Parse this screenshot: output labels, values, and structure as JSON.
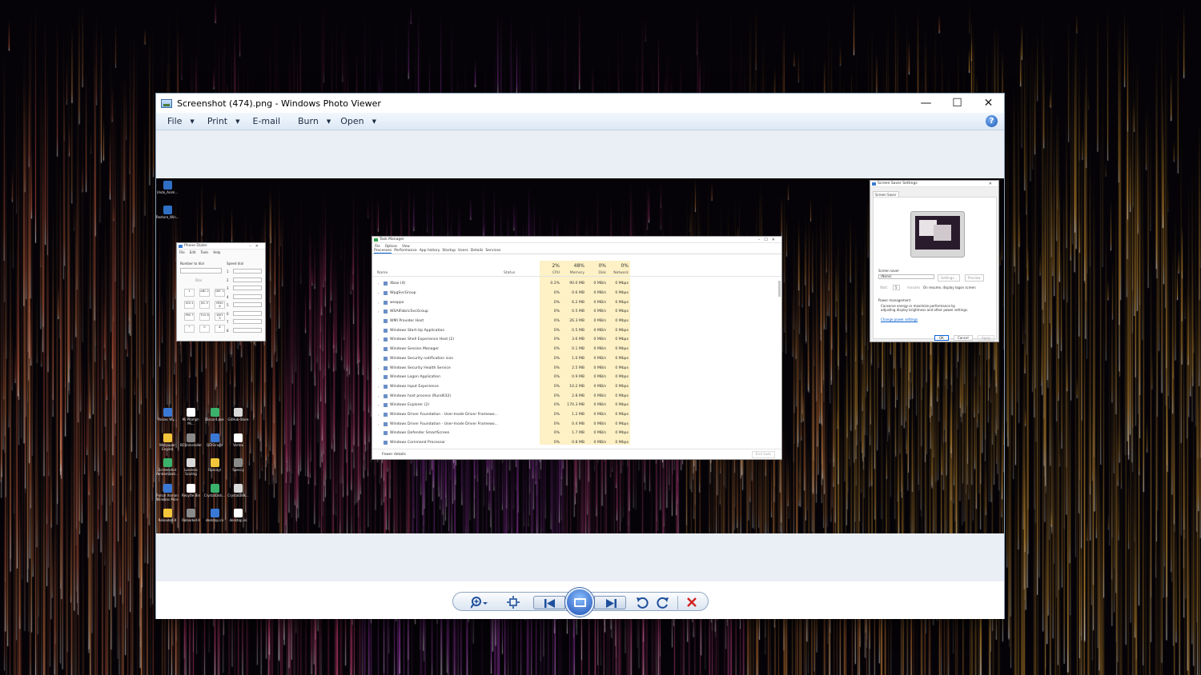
{
  "window": {
    "title": "Screenshot (474).png - Windows Photo Viewer",
    "controls": [
      "—",
      "☐",
      "✕"
    ]
  },
  "menu": [
    {
      "label": "File",
      "dropdown": true
    },
    {
      "label": "Print",
      "dropdown": true
    },
    {
      "label": "E-mail",
      "dropdown": false
    },
    {
      "label": "Burn",
      "dropdown": true
    },
    {
      "label": "Open",
      "dropdown": true
    }
  ],
  "help": {
    "label": "?"
  },
  "toolbar": {
    "zoom_icon": "zoom-icon",
    "fit_icon": "actual-size-icon",
    "prev_icon": "previous-icon",
    "slideshow_icon": "slideshow-icon",
    "next_icon": "next-icon",
    "rotate_ccw_icon": "rotate-counterclockwise-icon",
    "rotate_cw_icon": "rotate-clockwise-icon",
    "delete_icon": "delete-icon"
  },
  "photo": {
    "desktop_icons_top": [
      "Undo_Anim...",
      "Restore_Win..."
    ],
    "desktop_icons_grid": [
      [
        "Parsec Wy...",
        "Mi Prompt-Mi...",
        "Discord.exe",
        "GitHub-Store"
      ],
      [
        "Wallpaper Engine",
        "BCUninstaller",
        "QGIS/nuts",
        "Vortex"
      ],
      [
        "Screenshot randomizati...",
        "Lossless Scaling",
        "Upscayl",
        "Speccy"
      ],
      [
        "Pulsar Xlorion Wireless Mice",
        "Recycle Bin",
        "CrystalDisk...",
        "CrystalDisk..."
      ],
      [
        "Reloaded-II",
        "Reloaded-II",
        "desktop.ini",
        "desktop.ini"
      ]
    ],
    "phone_dialer": {
      "title": "Phone Dialer",
      "menu": [
        "File",
        "Edit",
        "Tools",
        "Help"
      ],
      "number_label": "Number to dial",
      "speed_label": "Speed dial",
      "dial_label": "Dial",
      "keys": [
        "1",
        "ABC 2",
        "DEF 3",
        "GHI 4",
        "JKL 5",
        "MNO 6",
        "PRS 7",
        "TUV 8",
        "WXY 9",
        "*",
        "0",
        "#"
      ],
      "speed_numbers": [
        "1",
        "2",
        "3",
        "4",
        "5",
        "6",
        "7",
        "8"
      ]
    },
    "task_manager": {
      "title": "Task Manager",
      "menu": [
        "File",
        "Options",
        "View"
      ],
      "tabs": [
        "Processes",
        "Performance",
        "App history",
        "Startup",
        "Users",
        "Details",
        "Services"
      ],
      "columns": {
        "name": "Name",
        "status": "Status",
        "cpu_pct": "2%",
        "cpu": "CPU",
        "mem_pct": "48%",
        "mem": "Memory",
        "disk_pct": "0%",
        "disk": "Disk",
        "net_pct": "0%",
        "net": "Network"
      },
      "rows": [
        {
          "name": "Xbox (4)",
          "cpu": "0.2%",
          "mem": "90.0 MB",
          "disk": "0 MB/s",
          "net": "0 Mbps",
          "expand": true
        },
        {
          "name": "WpgSvcGroup",
          "cpu": "0%",
          "mem": "0.6 MB",
          "disk": "0 MB/s",
          "net": "0 Mbps",
          "expand": true
        },
        {
          "name": "wsappx",
          "cpu": "0%",
          "mem": "6.2 MB",
          "disk": "0 MB/s",
          "net": "0 Mbps",
          "expand": true
        },
        {
          "name": "WSAIFabricSvcGroup",
          "cpu": "0%",
          "mem": "0.5 MB",
          "disk": "0 MB/s",
          "net": "0 Mbps",
          "expand": true
        },
        {
          "name": "WMI Provider Host",
          "cpu": "0%",
          "mem": "26.3 MB",
          "disk": "0 MB/s",
          "net": "0 Mbps",
          "expand": false
        },
        {
          "name": "Windows Start-Up Application",
          "cpu": "0%",
          "mem": "0.5 MB",
          "disk": "0 MB/s",
          "net": "0 Mbps",
          "expand": false
        },
        {
          "name": "Windows Shell Experience Host (2)",
          "cpu": "0%",
          "mem": "3.6 MB",
          "disk": "0 MB/s",
          "net": "0 Mbps",
          "expand": true
        },
        {
          "name": "Windows Session Manager",
          "cpu": "0%",
          "mem": "0.1 MB",
          "disk": "0 MB/s",
          "net": "0 Mbps",
          "expand": false
        },
        {
          "name": "Windows Security notification icon",
          "cpu": "0%",
          "mem": "1.0 MB",
          "disk": "0 MB/s",
          "net": "0 Mbps",
          "expand": false
        },
        {
          "name": "Windows Security Health Service",
          "cpu": "0%",
          "mem": "2.5 MB",
          "disk": "0 MB/s",
          "net": "0 Mbps",
          "expand": true
        },
        {
          "name": "Windows Logon Application",
          "cpu": "0%",
          "mem": "0.9 MB",
          "disk": "0 MB/s",
          "net": "0 Mbps",
          "expand": false
        },
        {
          "name": "Windows Input Experience",
          "cpu": "0%",
          "mem": "10.2 MB",
          "disk": "0 MB/s",
          "net": "0 Mbps",
          "expand": true
        },
        {
          "name": "Windows host process (Rundll32)",
          "cpu": "0%",
          "mem": "2.8 MB",
          "disk": "0 MB/s",
          "net": "0 Mbps",
          "expand": true
        },
        {
          "name": "Windows Explorer (2)",
          "cpu": "0%",
          "mem": "170.3 MB",
          "disk": "0 MB/s",
          "net": "0 Mbps",
          "expand": true
        },
        {
          "name": "Windows Driver Foundation - User-mode Driver Framewo...",
          "cpu": "0%",
          "mem": "1.2 MB",
          "disk": "0 MB/s",
          "net": "0 Mbps",
          "expand": true
        },
        {
          "name": "Windows Driver Foundation - User-mode Driver Framewo...",
          "cpu": "0%",
          "mem": "0.4 MB",
          "disk": "0 MB/s",
          "net": "0 Mbps",
          "expand": true
        },
        {
          "name": "Windows Defender SmartScreen",
          "cpu": "0%",
          "mem": "1.7 MB",
          "disk": "0 MB/s",
          "net": "0 Mbps",
          "expand": false
        },
        {
          "name": "Windows Command Processor",
          "cpu": "0%",
          "mem": "0.8 MB",
          "disk": "0 MB/s",
          "net": "0 Mbps",
          "expand": false
        }
      ],
      "fewer_details": "Fewer details",
      "end_task": "End task"
    },
    "screen_saver": {
      "title": "Screen Saver Settings",
      "tab": "Screen Saver",
      "group": "Screen saver",
      "selected": "(None)",
      "settings_btn": "Settings...",
      "preview_btn": "Preview",
      "wait_label": "Wait:",
      "wait_value": "5",
      "minutes_label": "minutes",
      "resume_label": "On resume, display logon screen",
      "power_group": "Power management",
      "power_text": "Conserve energy or maximize performance by adjusting display brightness and other power settings.",
      "power_link": "Change power settings",
      "ok": "OK",
      "cancel": "Cancel",
      "apply": "Apply"
    }
  }
}
